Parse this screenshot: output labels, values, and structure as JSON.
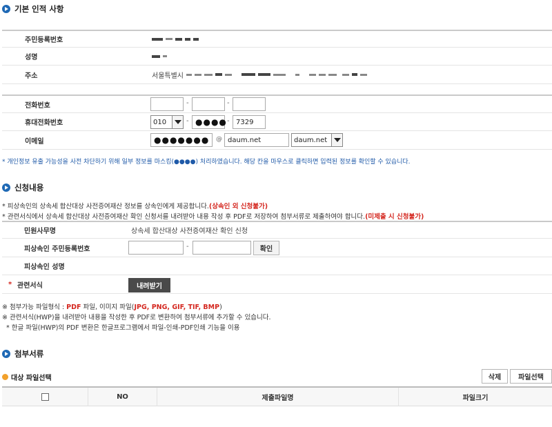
{
  "basic": {
    "title": "기본 인적 사항",
    "rows": {
      "rrn": "주민등록번호",
      "name": "성명",
      "address_label": "주소",
      "address_prefix": "서울특별시",
      "phone": "전화번호",
      "mobile": "휴대전화번호",
      "email": "이메일"
    },
    "mobile_prefix": "010",
    "mobile_middle": "●●●●",
    "mobile_last": "7329",
    "email_user": "●●●●●●●",
    "at": "@",
    "email_domain": "daum.net",
    "email_domain_select": "daum.net",
    "notice": "* 개인정보 유출 가능성을 사전 차단하기 위해 일부 정보를 마스킹(●●●●) 처리하였습니다. 해당 칸을 마우스로 클릭하면 입력된 정보를 확인할 수 있습니다."
  },
  "request": {
    "title": "신청내용",
    "note1_text": "* 피상속인의 상속세 합산대상 사전증여재산 정보를 상속인에게 제공합니다.",
    "note1_red": "(상속인 외 신청불가)",
    "note2_text": "* 관련서식에서 상속세 합산대상 사전증여재산 확인 신청서를 내려받아 내용 작성 후 PDF로 저장하여 첨부서류로 제출하여야 합니다.",
    "note2_red": "(미제출 시 신청불가)",
    "service_label": "민원사무명",
    "service_value": "상속세 합산대상 사전증여재산 확인 신청",
    "decedent_rrn_label": "피상속인 주민등록번호",
    "confirm_btn": "확인",
    "decedent_name_label": "피상속인 성명",
    "required_mark": "*",
    "forms_label": "관련서식",
    "download_btn": "내려받기",
    "file_note_a1": "※ 첨부가능 파일형식 : ",
    "file_note_a2": "PDF",
    "file_note_a3": " 파일, 이미지 파일(",
    "file_note_a4": "JPG, PNG, GIF, TIF, BMP",
    "file_note_a5": ")",
    "file_note_b": "※ 관련서식(HWP)을 내려받아 내용을 작성한 후 PDF로 변환하여 첨부서류에 추가할 수 있습니다.",
    "file_note_c": "* 한글 파일(HWP)의 PDF 변환은 한글프로그램에서 파일-인쇄-PDF인쇄 기능을 이용"
  },
  "attach": {
    "title": "첨부서류",
    "subtitle": "대상 파일선택",
    "delete_btn": "삭제",
    "select_btn": "파일선택",
    "col_no": "NO",
    "col_filename": "제출파일명",
    "col_size": "파일크기"
  }
}
